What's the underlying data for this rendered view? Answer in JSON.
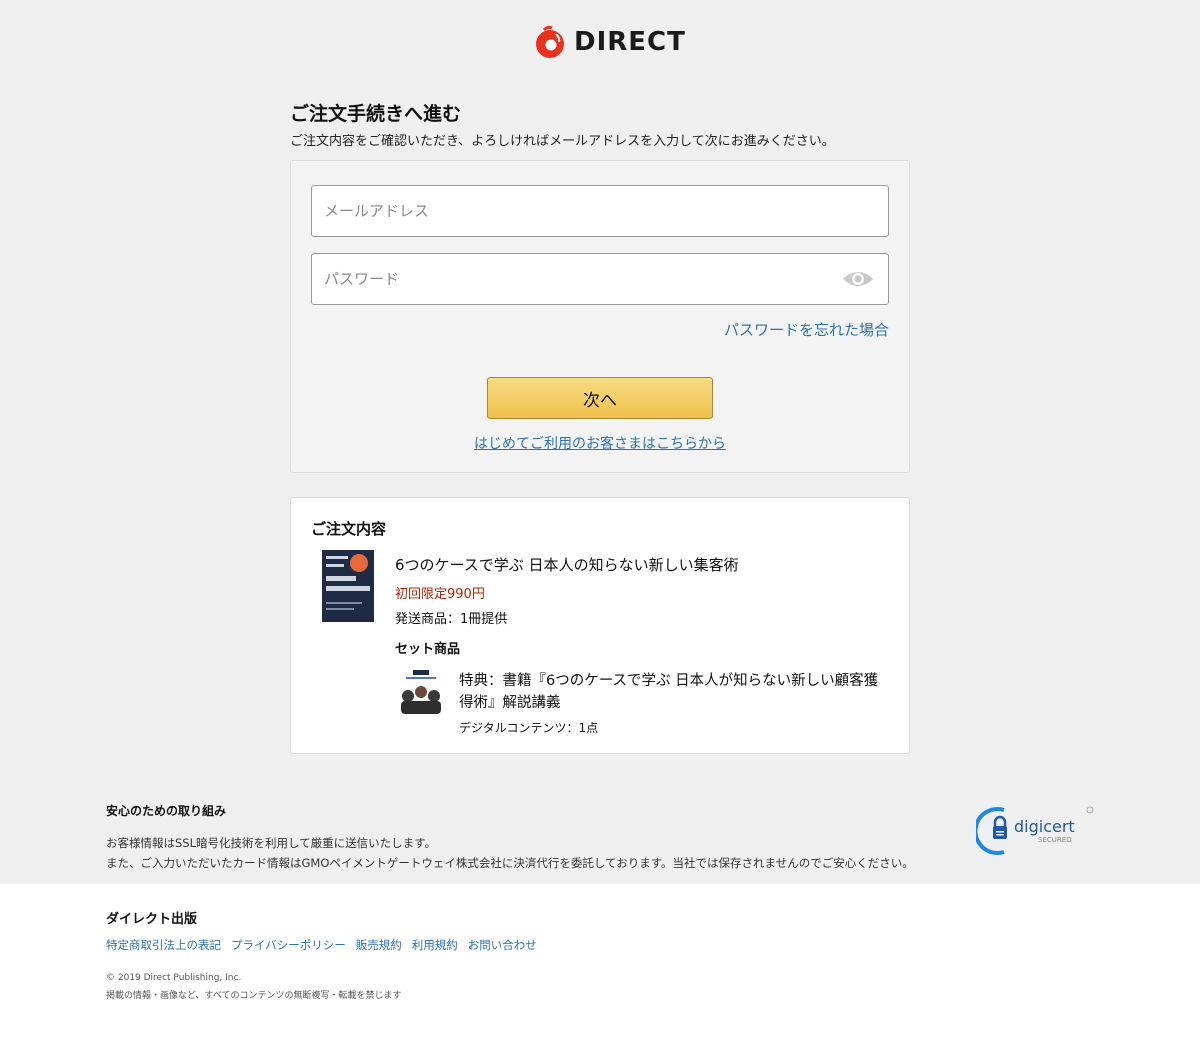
{
  "header": {
    "logo_text": "DIRECT",
    "brand_color": "#e8321f"
  },
  "main": {
    "title": "ご注文手続きへ進む",
    "description": "ご注文内容をご確認いただき、よろしければメールアドレスを入力して次にお進みください。"
  },
  "login": {
    "email_placeholder": "メールアドレス",
    "email_value": "",
    "password_placeholder": "パスワード",
    "password_value": "",
    "eye_icon": "eye-icon",
    "forgot_link": "パスワードを忘れた場合",
    "next_button": "次へ",
    "first_time_link": "はじめてご利用のお客さまはこちらから"
  },
  "order": {
    "title": "ご注文内容",
    "item_name": "6つのケースで学ぶ 日本人の知らない新しい集客術",
    "item_price": "初回限定990円",
    "item_shipping": "発送商品：1冊提供",
    "set_title": "セット商品",
    "bonus_name": "特典：書籍『6つのケースで学ぶ 日本人が知らない新しい顧客獲得術』解説講義",
    "bonus_qty": "デジタルコンテンツ：1点",
    "accent_color": "#b12704"
  },
  "security": {
    "title": "安心のための取り組み",
    "line1": "お客様情報はSSL暗号化技術を利用して厳重に送信いたします。",
    "line2": "また、ご入力いただいたカード情報はGMOペイメントゲートウェイ株式会社に決済代行を委託しております。当社では保存されませんのでご安心ください。",
    "badge_text": "digicert",
    "badge_sub": "SECURED"
  },
  "footer": {
    "company": "ダイレクト出版",
    "links": [
      "特定商取引法上の表記",
      "プライバシーポリシー",
      "販売規約",
      "利用規約",
      "お問い合わせ"
    ],
    "copyright": "© 2019 Direct Publishing, Inc.",
    "rights": "掲載の情報・画像など、すべてのコンテンツの無断複写・転載を禁じます",
    "link_color": "#2a73b5"
  }
}
